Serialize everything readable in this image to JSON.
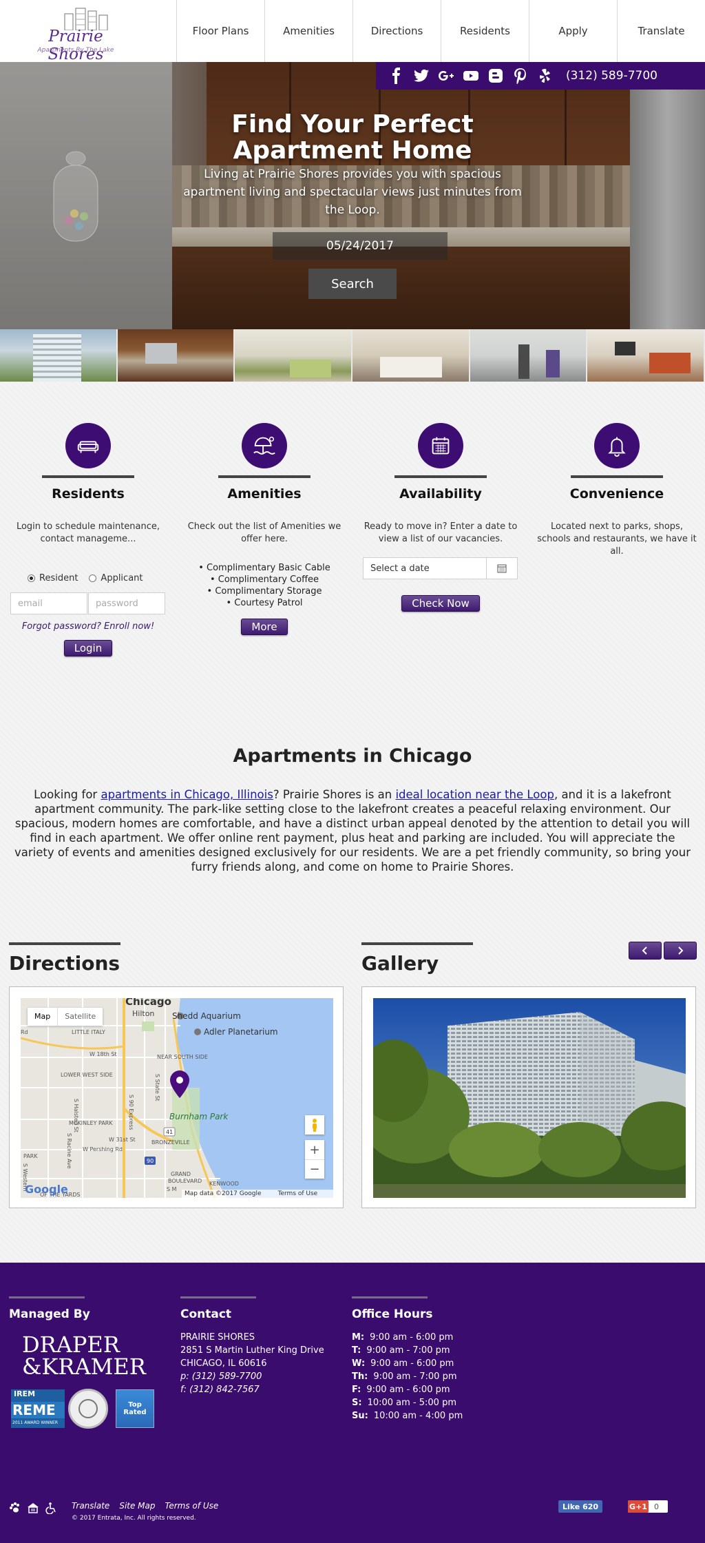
{
  "logo": {
    "name": "Prairie Shores",
    "tagline": "Apartments By The Lake"
  },
  "nav": [
    {
      "label": "Floor Plans"
    },
    {
      "label": "Amenities"
    },
    {
      "label": "Directions"
    },
    {
      "label": "Residents"
    },
    {
      "label": "Apply"
    },
    {
      "label": "Translate"
    }
  ],
  "social": {
    "icons": [
      "facebook-icon",
      "twitter-icon",
      "google-plus-icon",
      "youtube-icon",
      "blogger-icon",
      "pinterest-icon",
      "yelp-icon"
    ],
    "phone": "(312) 589-7700"
  },
  "hero": {
    "title": "Find Your Perfect Apartment Home",
    "subtitle": "Living at Prairie Shores provides you with spacious apartment living and spectacular views just minutes from the Loop.",
    "date": "05/24/2017",
    "search_label": "Search"
  },
  "features": {
    "residents": {
      "title": "Residents",
      "desc": "Login to schedule maintenance, contact manageme...",
      "radio_resident": "Resident",
      "radio_applicant": "Applicant",
      "email_placeholder": "email",
      "password_placeholder": "password",
      "forgot": "Forgot password? Enroll now!",
      "login": "Login"
    },
    "amenities": {
      "title": "Amenities",
      "desc": "Check out the list of Amenities we offer here.",
      "items": [
        "Complimentary Basic Cable",
        "Complimentary Coffee",
        "Complimentary Storage",
        "Courtesy Patrol"
      ],
      "more": "More"
    },
    "availability": {
      "title": "Availability",
      "desc": "Ready to move in? Enter a date to view a list of our vacancies.",
      "date_placeholder": "Select a date",
      "check": "Check Now"
    },
    "convenience": {
      "title": "Convenience",
      "desc": "Located next to parks, shops, schools and restaurants, we have it all."
    }
  },
  "apartments": {
    "title": "Apartments in Chicago",
    "p1": "Looking for ",
    "link1": "apartments in Chicago, Illinois",
    "p2": "? Prairie Shores is an ",
    "link2": "ideal location near the Loop",
    "p3": ", and it is a lakefront apartment community. The park-like setting close to the lakefront creates a peaceful relaxing environment. Our spacious, modern homes are comfortable, and have a distinct urban appeal denoted by the attention to detail you will find in each apartment. We offer online rent payment, plus heat and parking are included. You will appreciate the variety of events and amenities designed exclusively for our residents. We are a pet friendly community, so bring your furry friends along, and come on home to Prairie Shores."
  },
  "directions": {
    "title": "Directions",
    "map_tab": "Map",
    "satellite_tab": "Satellite",
    "labels": {
      "chicago": "Chicago",
      "hilton": "Hilton",
      "shedd": "Shedd Aquarium",
      "adler": "Adler Planetarium",
      "little_italy": "LITTLE ITALY",
      "near_south": "NEAR SOUTH SIDE",
      "lower_west": "LOWER WEST SIDE",
      "w18": "W 18th St",
      "burnham": "Burnham Park",
      "mckinley": "MCKINLEY PARK",
      "w31": "W 31st St",
      "w_pershing": "W Pershing Rd",
      "bronzeville": "BRONZEVILLE",
      "grand_blvd": "GRAND BOULEVARD",
      "kenwood": "KENWOOD",
      "park": "PARK",
      "yards": "OF THE YARDS",
      "route41": "41",
      "route90": "90",
      "halsted": "S Halsted St",
      "racine": "S Racine Ave",
      "express": "S 90 Express",
      "western": "S Western",
      "state": "S State St",
      "rd": "Rd",
      "sm": "S M"
    },
    "map_data": "Map data ©2017 Google",
    "terms": "Terms of Use",
    "google": "Google"
  },
  "gallery": {
    "title": "Gallery"
  },
  "footer": {
    "managed_title": "Managed By",
    "draper1": "DRAPER",
    "draper2": "&KRAMER",
    "irem": "IREM",
    "reme": "REME",
    "irem_award": "2011 AWARD WINNER",
    "top_rated": "Top Rated",
    "contact_title": "Contact",
    "contact_name": "PRAIRIE SHORES",
    "contact_addr1": "2851 S Martin Luther King Drive",
    "contact_addr2": "CHICAGO, IL 60616",
    "contact_phone": "p: (312) 589-7700",
    "contact_fax": "f: (312) 842-7567",
    "hours_title": "Office Hours",
    "hours": [
      {
        "day": "M:",
        "time": "9:00 am - 6:00 pm"
      },
      {
        "day": "T:",
        "time": "9:00 am - 7:00 pm"
      },
      {
        "day": "W:",
        "time": "9:00 am - 6:00 pm"
      },
      {
        "day": "Th:",
        "time": "9:00 am - 7:00 pm"
      },
      {
        "day": "F:",
        "time": "9:00 am - 6:00 pm"
      },
      {
        "day": "S:",
        "time": "10:00 am - 5:00 pm"
      },
      {
        "day": "Su:",
        "time": "10:00 am - 4:00 pm"
      }
    ],
    "links": [
      "Translate",
      "Site Map",
      "Terms of Use"
    ],
    "copyright": "© 2017 Entrata, Inc. All rights reserved.",
    "fb_like": "Like 620",
    "gplus": "G+1",
    "gplus_count": "0"
  }
}
